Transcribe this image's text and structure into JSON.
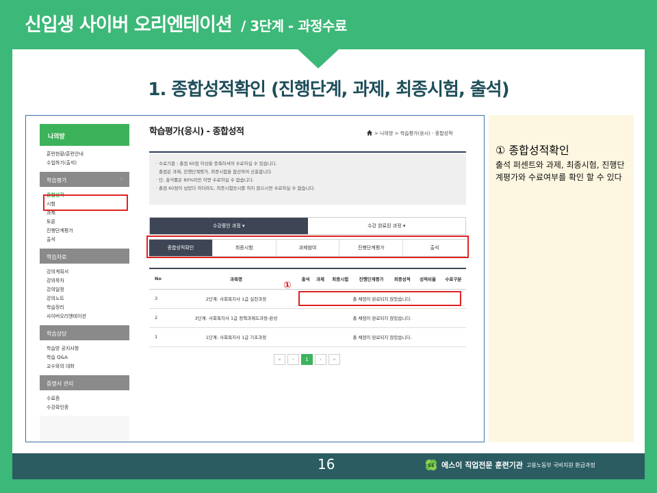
{
  "slide": {
    "title": "신입생 사이버 오리엔테이션",
    "subtitle": "/ 3단계 - 과정수료",
    "section_heading": "1. 종합성적확인 (진행단계, 과제, 최종시험, 출석)",
    "page_number": "16"
  },
  "footer": {
    "brand_name": "에스이 직업전문 훈련기관",
    "brand_tag": "고용노동부 국비지원 환급과정",
    "logo_icon": "clover-logo-icon"
  },
  "screenshot": {
    "sidebar": {
      "header": "나의방",
      "top_items": [
        "훈련현황/훈련안내",
        "수업하기(출석)"
      ],
      "groups": [
        {
          "label": "학습평가",
          "items": [
            "종합성적",
            "시험",
            "과제",
            "토론",
            "진행단계평가",
            "출석"
          ]
        },
        {
          "label": "학습자료",
          "items": [
            "강의계획서",
            "강의목차",
            "강의일정",
            "강의노트",
            "학습정리",
            "사이버오리엔테이션"
          ]
        },
        {
          "label": "학습상담",
          "items": [
            "학습방 공지사항",
            "학습 Q&A",
            "교수와의 대화"
          ]
        },
        {
          "label": "증명서 관리",
          "items": [
            "수료증",
            "수강확인증"
          ]
        }
      ],
      "group_toggle": "+"
    },
    "page_title": "학습평가(응시) - 종합성적",
    "breadcrumb": "> 나의방 > 학습평가(응시) - 종합성적",
    "notice": [
      "· 수료기준 : 총점 60점 이상을 충족하셔야 수료하실 수 있습니다.",
      "  총점은 과제, 진행단계평가, 최종시험을 합산하여 산출합니다.",
      "· 단, 출석률은 80%미만 이면 수료하실 수 없습니다.",
      "· 총점 60점이 넘었다 하더라도, 최종시험응시를 하지 않으시면 수료하실 수 없습니다."
    ],
    "course_tabs": [
      "수강중인 과정 ▾",
      "수강 완료된 과정 ▾"
    ],
    "sub_tabs": [
      "종합성적확인",
      "최종시험",
      "과제참여",
      "진행단계평가",
      "출석"
    ],
    "table": {
      "headers": [
        "No",
        "과목명",
        "출석",
        "과제",
        "최종시험",
        "진행단계평가",
        "최종성적",
        "성적비율",
        "수료구분"
      ],
      "rows": [
        {
          "no": "3",
          "course": "2단계: 사회복지사 1급 실천과정",
          "status": "총 채점이 완료되지 않았습니다."
        },
        {
          "no": "2",
          "course": "3단계: 사회복지사 1급 정책과제도과정-완성",
          "status": "총 채점이 완료되지 않았습니다."
        },
        {
          "no": "1",
          "course": "1단계: 사회복지사 1급 기초과정",
          "status": "총 채점이 완료되지 않았습니다."
        }
      ]
    },
    "pager": {
      "first": "«",
      "prev": "‹",
      "current": "1",
      "next": "›",
      "last": "»"
    },
    "marker": "①"
  },
  "explain": {
    "heading": "① 종합성적확인",
    "body": "출석 퍼센트와 과제, 최종시험, 진행단계평가와 수료여부를 확인 할 수 있다"
  },
  "colors": {
    "green": "#3cb878",
    "footer": "#2a5c62",
    "highlight": "#e02020",
    "note_bg": "#fdf7e1"
  }
}
